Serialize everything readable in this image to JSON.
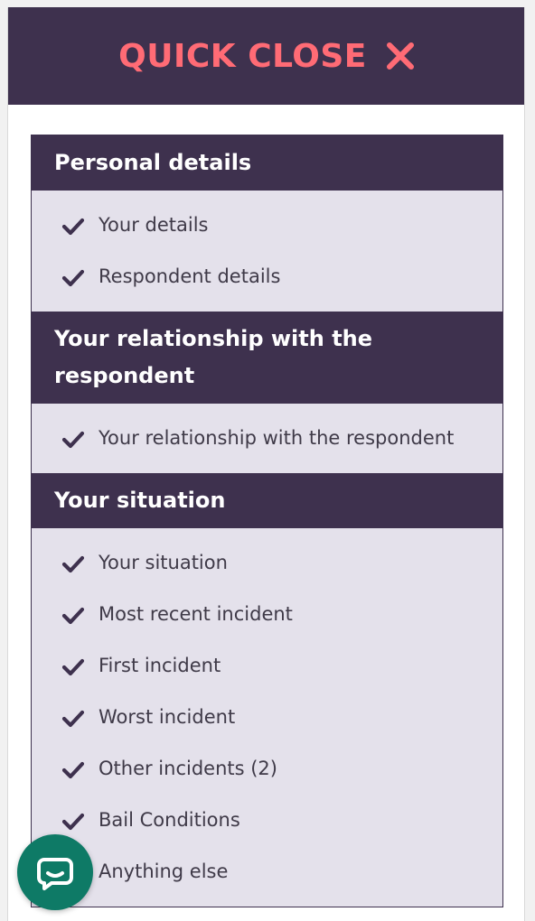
{
  "quick_close": {
    "label": "QUICK CLOSE",
    "icon": "close-icon",
    "bg_color": "#3e314e",
    "text_color": "#ff6b75"
  },
  "sections": [
    {
      "title": "Personal details",
      "items": [
        "Your details",
        "Respondent details"
      ]
    },
    {
      "title": "Your relationship with the respondent",
      "items": [
        "Your relationship with the respondent"
      ]
    },
    {
      "title": "Your situation",
      "items": [
        "Your situation",
        "Most recent incident",
        "First incident",
        "Worst incident",
        "Other incidents (2)",
        "Bail Conditions",
        "Anything else"
      ]
    }
  ],
  "chat": {
    "icon": "chat-bubble-icon",
    "color": "#0e7a66"
  },
  "colors": {
    "header_bg": "#3e314e",
    "list_bg": "#e4e1eb",
    "item_text": "#3f3a48",
    "check": "#3e314e"
  }
}
